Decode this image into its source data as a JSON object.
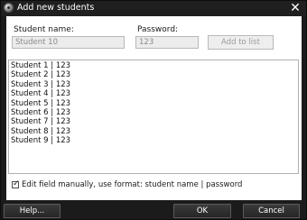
{
  "window": {
    "title": "Add new students",
    "close_label": "✕"
  },
  "form": {
    "student_name_label": "Student name:",
    "student_name_value": "Student 10",
    "password_label": "Password:",
    "password_value": "123",
    "add_button_label": "Add to list"
  },
  "list": {
    "lines": [
      "Student 1 | 123",
      "Student 2 | 123",
      "Student 3 | 123",
      "Student 4 | 123",
      "Student 5 | 123",
      "Student 6 | 123",
      "Student 7 | 123",
      "Student 8 | 123",
      "Student 9 | 123"
    ]
  },
  "manual_edit": {
    "checked": true,
    "label": "Edit field manually, use format: student name | password"
  },
  "footer": {
    "help_label": "Help...",
    "ok_label": "OK",
    "cancel_label": "Cancel"
  },
  "colors": {
    "chrome": "#1b1b1b",
    "content": "#ffffff",
    "disabled_text": "#8a8a8a"
  }
}
